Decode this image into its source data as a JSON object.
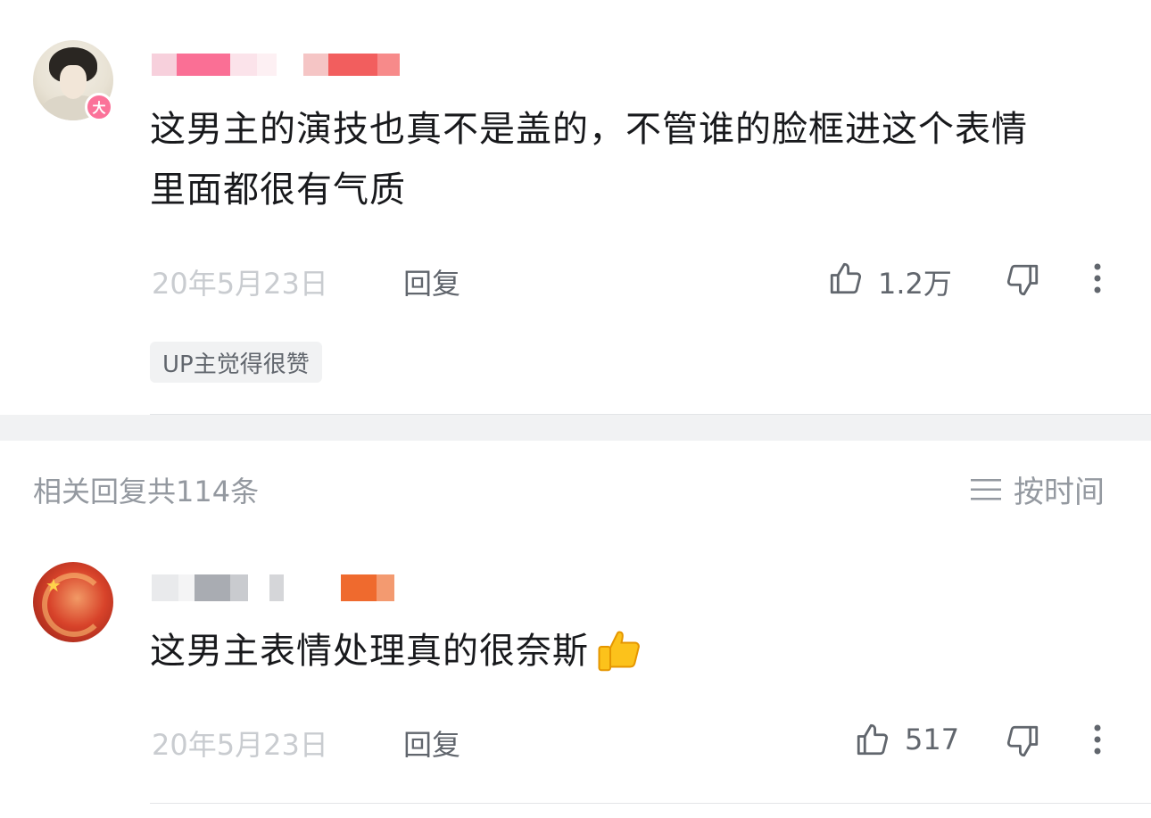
{
  "main_comment": {
    "text_line1": "这男主的演技也真不是盖的，不管谁的脸框进这个表情",
    "text_line2": "里面都很有气质",
    "date": "20年5月23日",
    "reply_label": "回复",
    "like_count": "1.2万",
    "vip_badge": "大",
    "up_tag": "UP主觉得很赞"
  },
  "replies_header": {
    "title": "相关回复共114条",
    "sort_label": "按时间"
  },
  "reply_comment": {
    "text": "这男主表情处理真的很奈斯",
    "date": "20年5月23日",
    "reply_label": "回复",
    "like_count": "517"
  },
  "icons": {
    "like": "thumbs-up-outline-icon",
    "dislike": "thumbs-down-outline-icon",
    "more": "vertical-ellipsis-icon",
    "sort": "hamburger-list-icon",
    "emoji": "thumbs-up-emoji"
  },
  "colors": {
    "primary_text": "#18191c",
    "secondary_text": "#61666d",
    "date_text": "#c9ccd0",
    "badge_pink": "#fb7299",
    "background_gray": "#f1f2f3"
  }
}
